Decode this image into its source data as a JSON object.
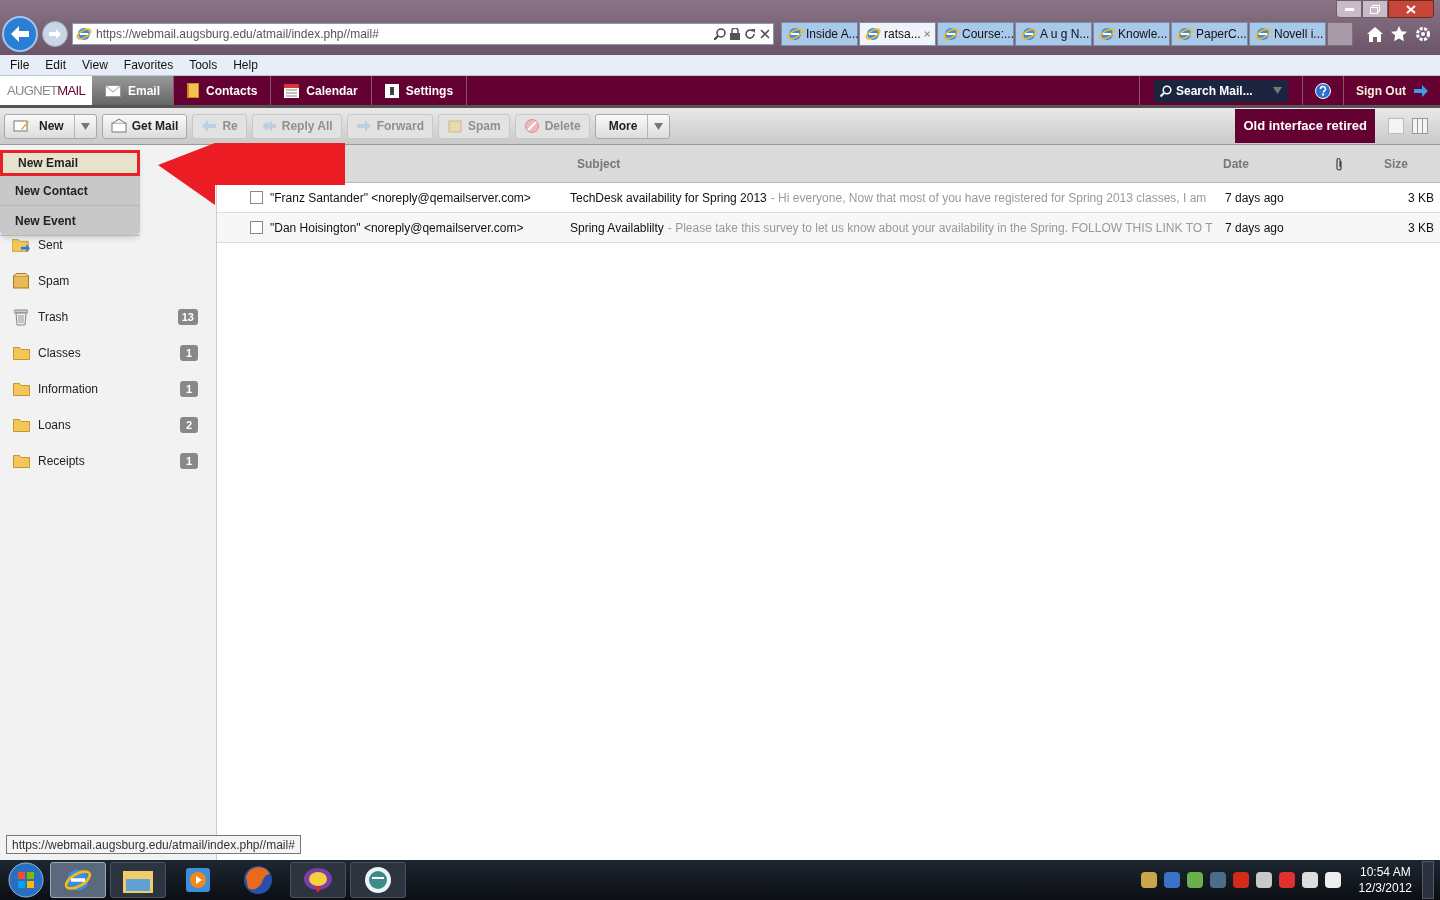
{
  "browser": {
    "address": "https://webmail.augsburg.edu/atmail/index.php//mail#",
    "tabs": [
      {
        "label": "Inside A...",
        "selected": false
      },
      {
        "label": "ratsa...",
        "selected": true
      },
      {
        "label": "Course:...",
        "selected": false
      },
      {
        "label": "A u g N...",
        "selected": false
      },
      {
        "label": "Knowle...",
        "selected": false
      },
      {
        "label": "PaperC...",
        "selected": false
      },
      {
        "label": "Novell i...",
        "selected": false
      }
    ]
  },
  "menu_bar": [
    "File",
    "Edit",
    "View",
    "Favorites",
    "Tools",
    "Help"
  ],
  "app": {
    "logo": {
      "first": "AUGNET",
      "second": "MAIL"
    },
    "nav": [
      {
        "label": "Email",
        "selected": true,
        "kind": "mail"
      },
      {
        "label": "Contacts",
        "selected": false,
        "kind": "book"
      },
      {
        "label": "Calendar",
        "selected": false,
        "kind": "calendar"
      },
      {
        "label": "Settings",
        "selected": false,
        "kind": "settings"
      }
    ],
    "search": {
      "placeholder": "Search Mail..."
    },
    "sign_out": "Sign Out"
  },
  "toolbar": {
    "buttons": [
      {
        "label": "New",
        "kind": "split",
        "disabled": false
      },
      {
        "label": "Get Mail",
        "kind": "plain",
        "disabled": false
      },
      {
        "label": "Re",
        "kind": "plain",
        "disabled": true
      },
      {
        "label": "Reply All",
        "kind": "plain",
        "disabled": true
      },
      {
        "label": "Forward",
        "kind": "plain",
        "disabled": true
      },
      {
        "label": "Spam",
        "kind": "plain",
        "disabled": true
      },
      {
        "label": "Delete",
        "kind": "plain",
        "disabled": true
      },
      {
        "label": "More",
        "kind": "split",
        "disabled": false
      }
    ],
    "notice": "Old interface retired"
  },
  "new_menu": [
    {
      "label": "New Email",
      "selected": true
    },
    {
      "label": "New Contact",
      "selected": false
    },
    {
      "label": "New Event",
      "selected": false
    }
  ],
  "folders": [
    {
      "name": "Sent",
      "kind": "sent"
    },
    {
      "name": "Spam",
      "kind": "spam"
    },
    {
      "name": "Trash",
      "kind": "trash",
      "count": "13"
    },
    {
      "name": "Classes",
      "kind": "folder",
      "count": "1"
    },
    {
      "name": "Information",
      "kind": "folder",
      "count": "1"
    },
    {
      "name": "Loans",
      "kind": "folder",
      "count": "2"
    },
    {
      "name": "Receipts",
      "kind": "folder",
      "count": "1"
    }
  ],
  "table": {
    "columns": {
      "subject": "Subject",
      "date": "Date",
      "size": "Size"
    },
    "rows": [
      {
        "from": "\"Franz Santander\" <noreply@qemailserver.com>",
        "subject": "TechDesk availability for Spring 2013",
        "preview": "- Hi everyone, Now that most of you have registered for Spring 2013 classes, I am",
        "date": "7 days ago",
        "size": "3 KB",
        "checked": false
      },
      {
        "from": "\"Dan Hoisington\" <noreply@qemailserver.com>",
        "subject": "Spring Availablilty",
        "preview": "- Please take this survey to let us know about your availability in the Spring. FOLLOW THIS LINK TO T",
        "date": "7 days ago",
        "size": "3 KB",
        "checked": false
      }
    ]
  },
  "status_tooltip": "https://webmail.augsburg.edu/atmail/index.php//mail#",
  "clock": {
    "time": "10:54 AM",
    "date": "12/3/2012"
  }
}
